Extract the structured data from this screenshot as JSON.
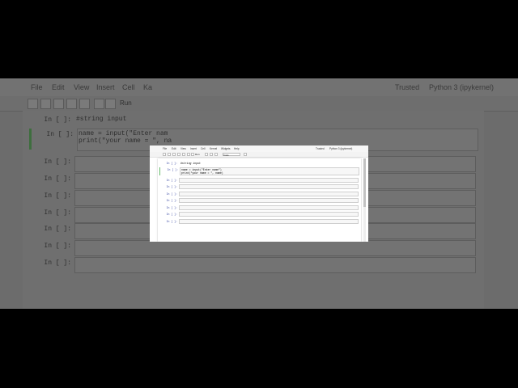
{
  "menu": [
    "File",
    "Edit",
    "View",
    "Insert",
    "Cell",
    "Kernel",
    "Widgets",
    "Help"
  ],
  "kernel_label": "Python 3 (ipykernel)",
  "trusted_label": "Trusted",
  "toolbar": {
    "run_label": "Run",
    "cell_type": "Code"
  },
  "prompt": "In [ ]:",
  "cells": [
    {
      "code_comment": "#string input"
    },
    {
      "line1": "name = input(\"Enter name\")",
      "line2": "print(\"your name = \", name)"
    }
  ],
  "empty_cell_count": 7,
  "background": {
    "menu": [
      "File",
      "Edit",
      "View",
      "Insert",
      "Cell",
      "Ka"
    ],
    "kernel_label": "Python 3 (ipykernel)",
    "trusted_label": "Trusted",
    "run_label": "Run",
    "cell1": "#string input",
    "cell2_line1": "name = input(\"Enter nam",
    "cell2_line2": "print(\"your name = \", na"
  }
}
